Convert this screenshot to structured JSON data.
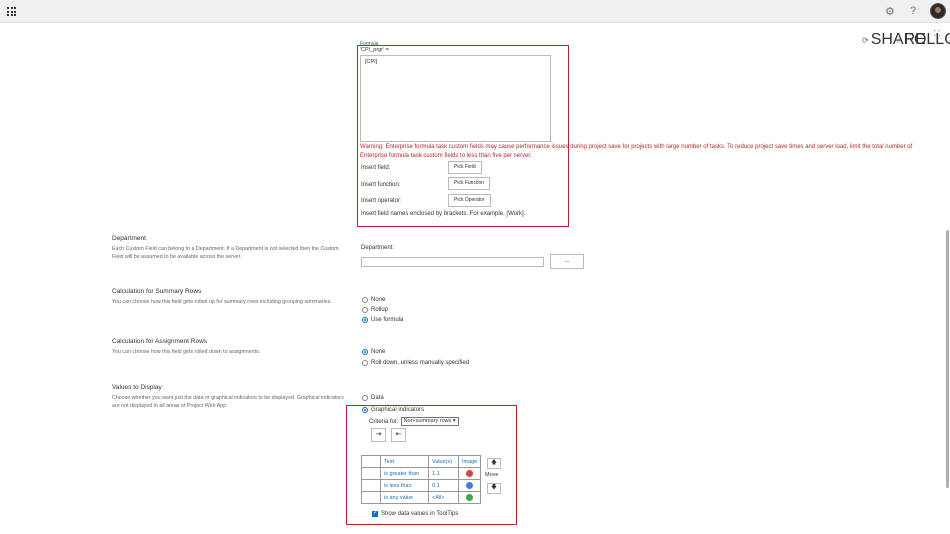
{
  "topbar": {
    "settings_icon": "gear-icon",
    "help_icon": "question-mark-icon",
    "help_glyph": "?",
    "avatar_icon": "user-avatar"
  },
  "actions": {
    "share_label": "SHARE",
    "follow_label": "FOLLOW",
    "focus_icon": "focus-mode-icon"
  },
  "formula": {
    "option_label": "Formula",
    "field_name": "'CPI_prgr' =",
    "value": "[CPI]",
    "warning": "Warning: Enterprise formula task custom fields may cause performance issues during project save for projects with large number of tasks. To reduce project save times and server load, limit the total number of Enterprise formula task custom fields to less than five per server.",
    "insert_field_label": "Insert field:",
    "pick_field": "Pick Field",
    "insert_function_label": "Insert function:",
    "pick_function": "Pick Function",
    "insert_operator_label": "Insert operator:",
    "pick_operator": "Pick Operator",
    "hint": "Insert field names enclosed by brackets. For example, [Work]."
  },
  "department": {
    "title": "Department",
    "description": "Each Custom Field can belong to a Department. If a Department is not selected then the Custom Field will be assumed to be available across the server.",
    "label": "Department:",
    "browse": "..."
  },
  "summary_rows": {
    "title": "Calculation for Summary Rows",
    "description": "You can choose how this field gets rolled up for summary rows including grouping summaries.",
    "options": [
      "None",
      "Rollup",
      "Use formula"
    ],
    "selected": "Use formula"
  },
  "assignment_rows": {
    "title": "Calculation for Assignment Rows",
    "description": "You can choose how this field gets rolled down to assignments.",
    "options": [
      "None",
      "Roll down, unless manually specified"
    ],
    "selected": "None"
  },
  "values_display": {
    "title": "Values to Display",
    "description": "Choose whether you want just the data or graphical indicators to be displayed. Graphical indicators are not displayed in all areas of Project Web App.",
    "options": [
      "Data",
      "Graphical indicators"
    ],
    "selected": "Graphical indicators",
    "criteria_label": "Criteria for:",
    "criteria_value": "Non-summary rows",
    "table_headers": [
      "Test",
      "Value(s)",
      "Image"
    ],
    "rows": [
      {
        "test": "is greater than",
        "value": "1.1",
        "image": "red-circle",
        "color": "#e04040"
      },
      {
        "test": "is less than",
        "value": "0.1",
        "image": "blue-circle",
        "color": "#3f7fd8"
      },
      {
        "test": "is any value",
        "value": "<All>",
        "image": "green-circle",
        "color": "#3aa843"
      }
    ],
    "move_label": "Move",
    "show_tooltips": "Show data values in ToolTips"
  }
}
